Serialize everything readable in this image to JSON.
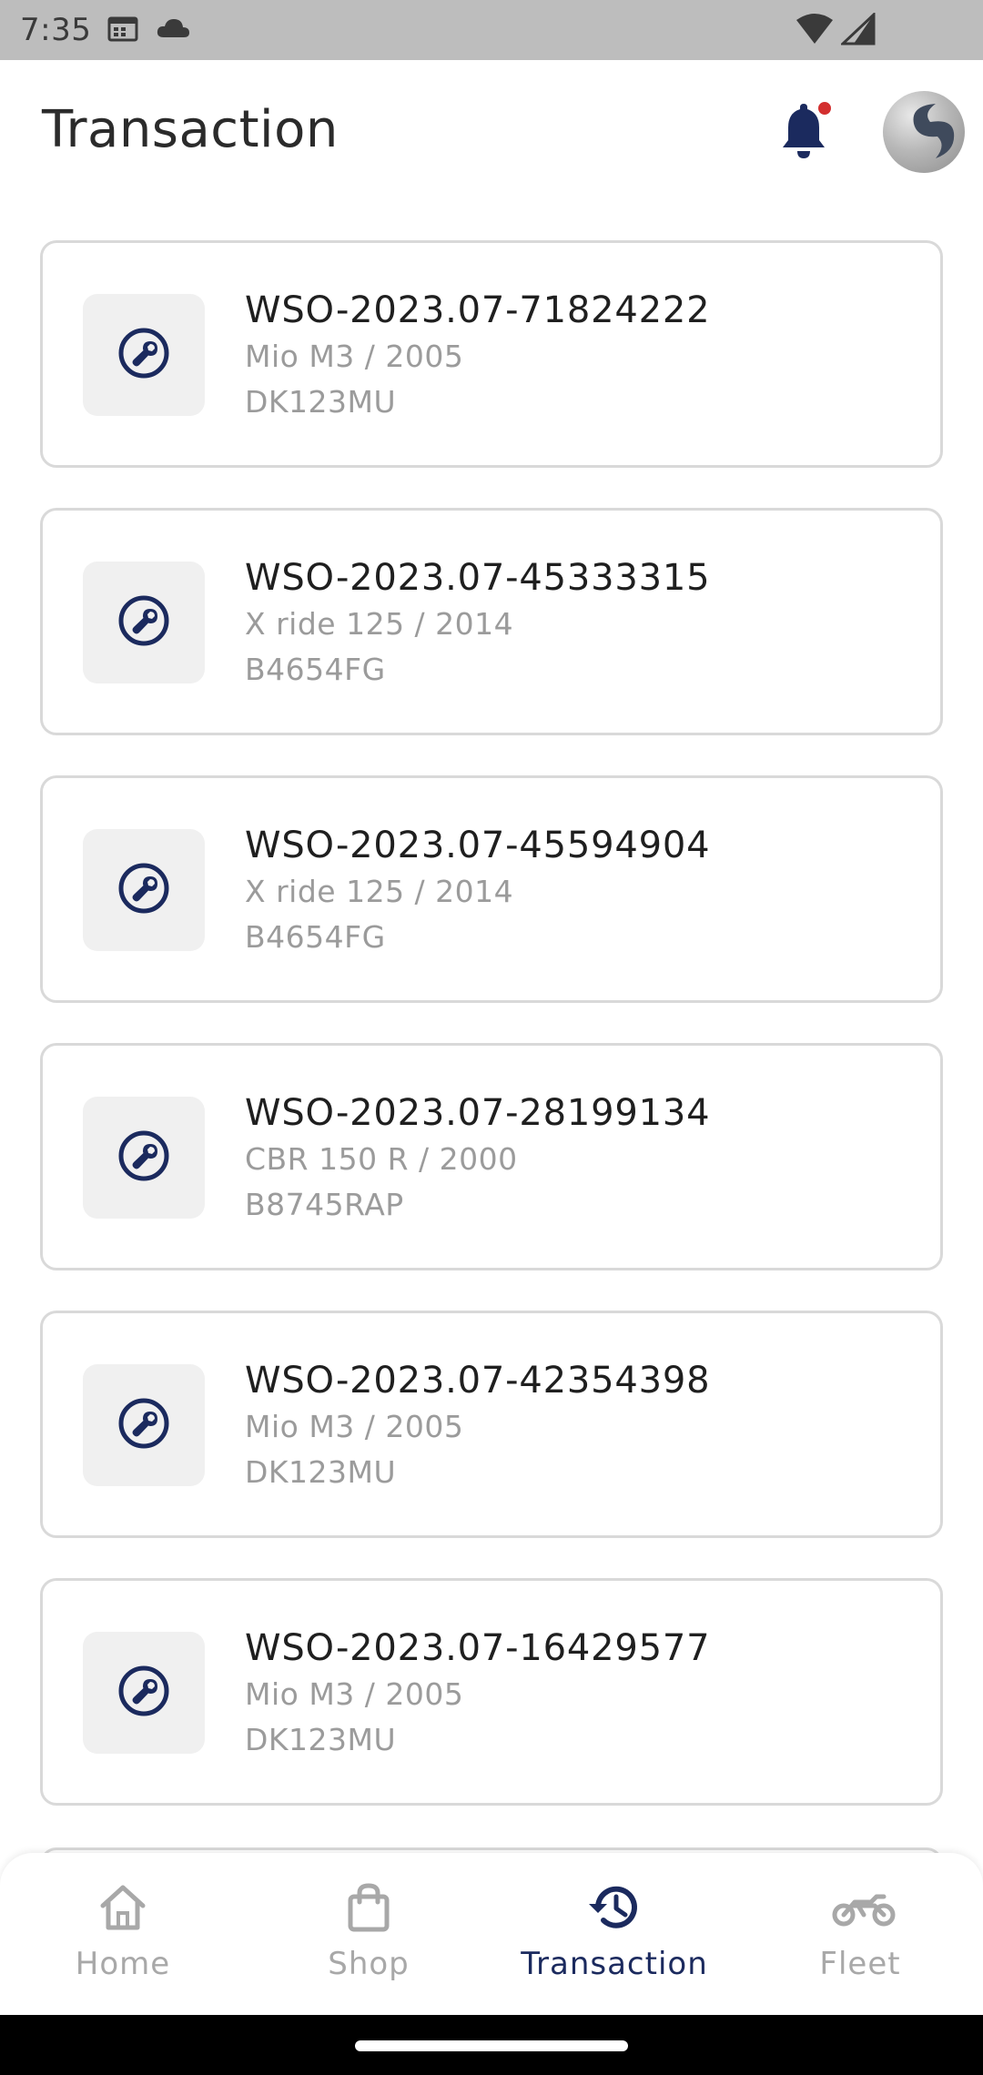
{
  "status_bar": {
    "time": "7:35"
  },
  "header": {
    "title": "Transaction"
  },
  "colors": {
    "accent": "#1b2a5e",
    "notification_dot": "#d32f2f"
  },
  "transactions": [
    {
      "id": "WSO-2023.07-71824222",
      "vehicle": "Mio M3 / 2005",
      "plate": "DK123MU"
    },
    {
      "id": "WSO-2023.07-45333315",
      "vehicle": "X ride 125 / 2014",
      "plate": "B4654FG"
    },
    {
      "id": "WSO-2023.07-45594904",
      "vehicle": "X ride 125 / 2014",
      "plate": "B4654FG"
    },
    {
      "id": "WSO-2023.07-28199134",
      "vehicle": "CBR 150 R / 2000",
      "plate": "B8745RAP"
    },
    {
      "id": "WSO-2023.07-42354398",
      "vehicle": "Mio M3 / 2005",
      "plate": "DK123MU"
    },
    {
      "id": "WSO-2023.07-16429577",
      "vehicle": "Mio M3 / 2005",
      "plate": "DK123MU"
    }
  ],
  "bottom_nav": {
    "items": [
      {
        "label": "Home",
        "icon": "home-icon",
        "active": false
      },
      {
        "label": "Shop",
        "icon": "shopping-bag-icon",
        "active": false
      },
      {
        "label": "Transaction",
        "icon": "history-icon",
        "active": true
      },
      {
        "label": "Fleet",
        "icon": "motorcycle-icon",
        "active": false
      }
    ]
  }
}
